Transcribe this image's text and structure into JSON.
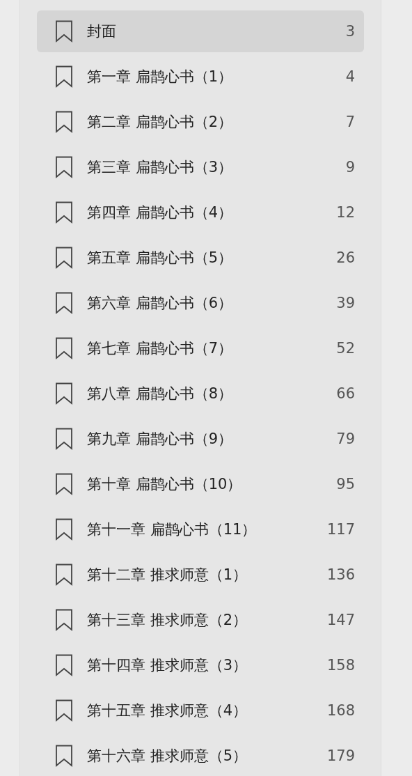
{
  "toc": {
    "items": [
      {
        "title": "封面",
        "page": "3",
        "selected": true
      },
      {
        "title": "第一章 扁鹊心书（1）",
        "page": "4",
        "selected": false
      },
      {
        "title": "第二章 扁鹊心书（2）",
        "page": "7",
        "selected": false
      },
      {
        "title": "第三章 扁鹊心书（3）",
        "page": "9",
        "selected": false
      },
      {
        "title": "第四章 扁鹊心书（4）",
        "page": "12",
        "selected": false
      },
      {
        "title": "第五章 扁鹊心书（5）",
        "page": "26",
        "selected": false
      },
      {
        "title": "第六章 扁鹊心书（6）",
        "page": "39",
        "selected": false
      },
      {
        "title": "第七章 扁鹊心书（7）",
        "page": "52",
        "selected": false
      },
      {
        "title": "第八章 扁鹊心书（8）",
        "page": "66",
        "selected": false
      },
      {
        "title": "第九章 扁鹊心书（9）",
        "page": "79",
        "selected": false
      },
      {
        "title": "第十章 扁鹊心书（10）",
        "page": "95",
        "selected": false
      },
      {
        "title": "第十一章 扁鹊心书（11）",
        "page": "117",
        "selected": false
      },
      {
        "title": "第十二章 推求师意（1）",
        "page": "136",
        "selected": false
      },
      {
        "title": "第十三章 推求师意（2）",
        "page": "147",
        "selected": false
      },
      {
        "title": "第十四章 推求师意（3）",
        "page": "158",
        "selected": false
      },
      {
        "title": "第十五章 推求师意（4）",
        "page": "168",
        "selected": false
      },
      {
        "title": "第十六章 推求师意（5）",
        "page": "179",
        "selected": false
      }
    ]
  }
}
